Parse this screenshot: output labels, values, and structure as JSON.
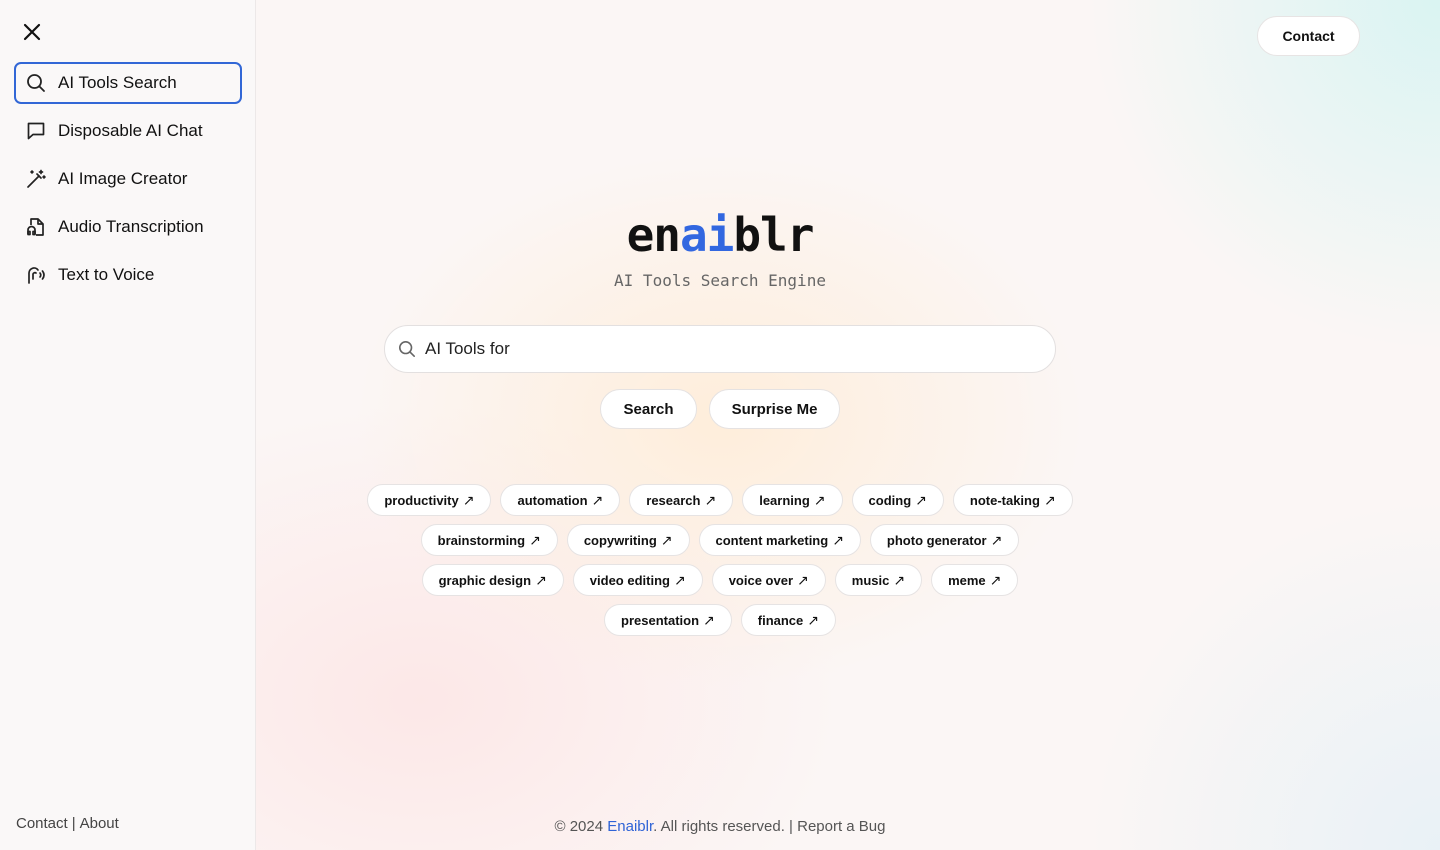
{
  "sidebar": {
    "items": [
      {
        "label": "AI Tools Search",
        "icon": "search-icon",
        "active": true
      },
      {
        "label": "Disposable AI Chat",
        "icon": "chat-icon",
        "active": false
      },
      {
        "label": "AI Image Creator",
        "icon": "magic-wand-icon",
        "active": false
      },
      {
        "label": "Audio Transcription",
        "icon": "audio-file-icon",
        "active": false
      },
      {
        "label": "Text to Voice",
        "icon": "voice-icon",
        "active": false
      }
    ],
    "footer": {
      "contact": "Contact",
      "separator": "|",
      "about": "About"
    }
  },
  "header": {
    "contact": "Contact"
  },
  "brand": {
    "part1": "en",
    "part2": "ai",
    "part3": "blr",
    "tagline": "AI Tools Search Engine"
  },
  "search": {
    "placeholder": "AI Tools for",
    "search_label": "Search",
    "surprise_label": "Surprise Me"
  },
  "tags": [
    [
      "productivity",
      "automation",
      "research",
      "learning",
      "coding",
      "note-taking"
    ],
    [
      "brainstorming",
      "copywriting",
      "content marketing",
      "photo generator"
    ],
    [
      "graphic design",
      "video editing",
      "voice over",
      "music",
      "meme"
    ],
    [
      "presentation",
      "finance"
    ]
  ],
  "tag_arrow": "↗",
  "footer": {
    "copyright": "© 2024 ",
    "brand": "Enaiblr",
    "rights": ". All rights reserved. ",
    "sep": "|",
    "bug": " Report a Bug"
  },
  "colors": {
    "accent": "#3267e0",
    "active_border": "#3267d6"
  }
}
